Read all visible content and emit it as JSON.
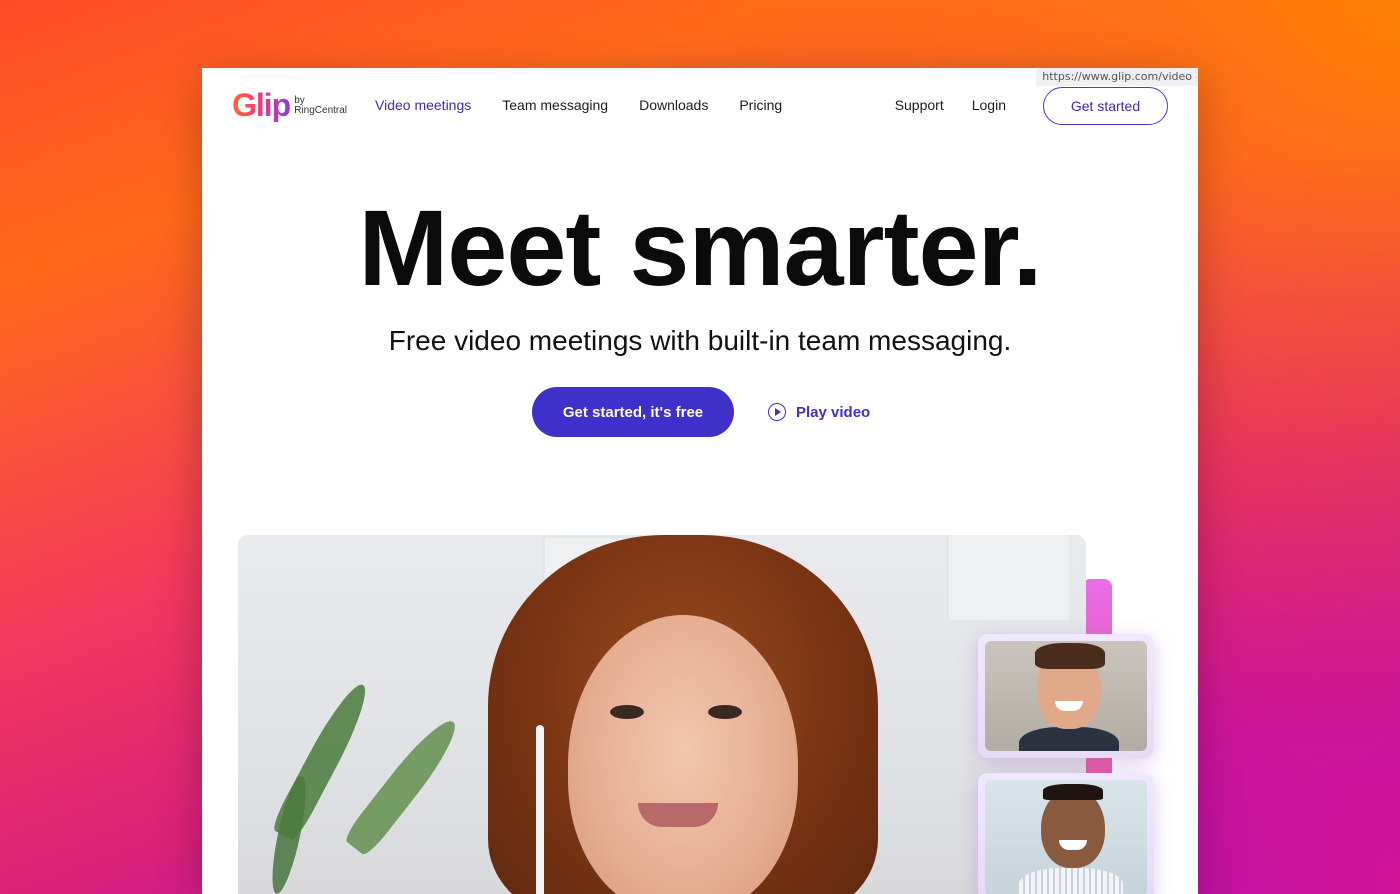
{
  "browser": {
    "hover_url": "https://www.glip.com/video"
  },
  "logo": {
    "word": "Glip",
    "by": "by",
    "company": "RingCentral"
  },
  "nav": {
    "links": [
      {
        "label": "Video meetings",
        "active": true
      },
      {
        "label": "Team messaging",
        "active": false
      },
      {
        "label": "Downloads",
        "active": false
      },
      {
        "label": "Pricing",
        "active": false
      }
    ],
    "support_label": "Support",
    "login_label": "Login",
    "get_started_label": "Get started"
  },
  "hero": {
    "title": "Meet smarter.",
    "subtitle": "Free video meetings with built-in team messaging.",
    "primary_cta": "Get started, it's free",
    "play_video_label": "Play video"
  },
  "colors": {
    "brand_primary": "#3e30c8",
    "active_link": "#3a2fb0",
    "accent_pink": "#ea6de8"
  },
  "icons": {
    "play": "play-circle-icon"
  }
}
